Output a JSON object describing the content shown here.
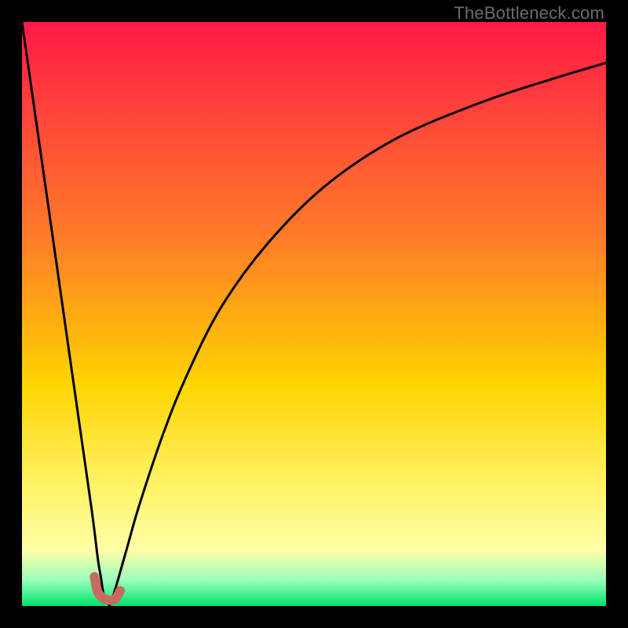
{
  "watermark": "TheBottleneck.com",
  "chart_data": {
    "type": "line",
    "title": "",
    "xlabel": "",
    "ylabel": "",
    "xlim": [
      0,
      100
    ],
    "ylim": [
      0,
      100
    ],
    "grid": false,
    "legend": false,
    "gradient_stops": [
      {
        "offset": 0,
        "color": "#ff1a47"
      },
      {
        "offset": 0.38,
        "color": "#ff7f27"
      },
      {
        "offset": 0.62,
        "color": "#ffd400"
      },
      {
        "offset": 0.8,
        "color": "#fff46a"
      },
      {
        "offset": 0.905,
        "color": "#fffea6"
      },
      {
        "offset": 0.955,
        "color": "#9bffbd"
      },
      {
        "offset": 1.0,
        "color": "#00e36b"
      }
    ],
    "series": [
      {
        "name": "bottleneck-curve-left",
        "x": [
          0,
          2,
          4,
          6,
          8,
          10,
          12,
          13,
          13.5,
          14,
          15
        ],
        "y": [
          100,
          86,
          72,
          58,
          44,
          30,
          16,
          8,
          5,
          2,
          0
        ]
      },
      {
        "name": "bottleneck-curve-right",
        "x": [
          15,
          16,
          18,
          20,
          24,
          28,
          34,
          42,
          52,
          64,
          78,
          90,
          100
        ],
        "y": [
          0,
          3,
          10,
          17,
          29,
          39,
          51,
          62,
          72,
          80,
          86,
          90,
          93
        ]
      }
    ],
    "marker": {
      "name": "selected-point",
      "color": "#c76a62",
      "stroke_width": 12,
      "path_xy": [
        [
          12.4,
          5.0
        ],
        [
          13.0,
          2.4
        ],
        [
          14.2,
          1.2
        ],
        [
          15.8,
          1.1
        ],
        [
          16.8,
          2.6
        ]
      ]
    }
  }
}
